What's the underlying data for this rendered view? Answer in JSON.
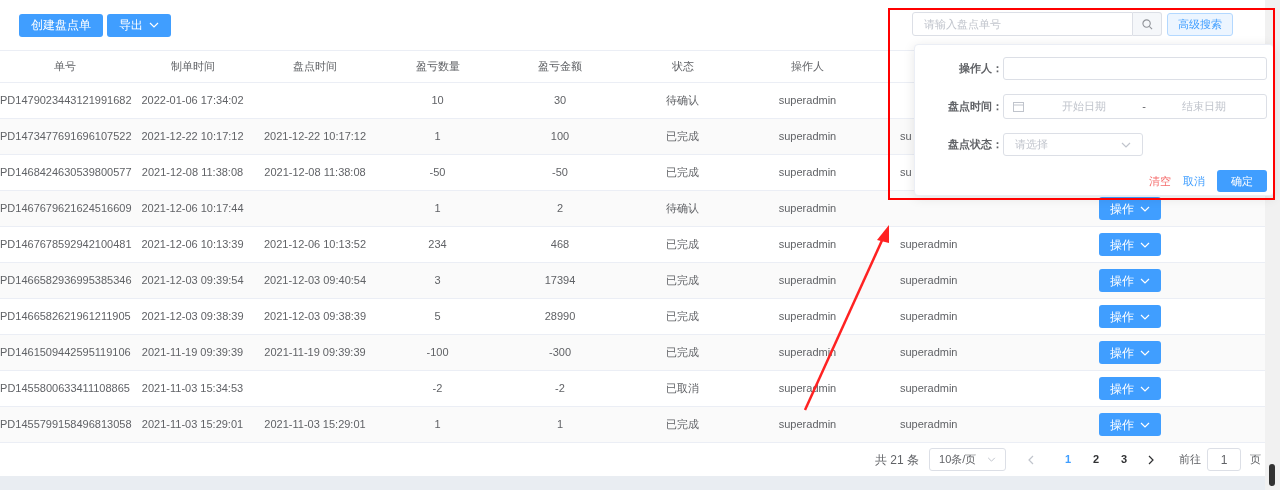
{
  "toolbar": [
    {
      "label": "创建盘点单",
      "kind": "plain"
    },
    {
      "label": "导出",
      "kind": "dropdown"
    }
  ],
  "search": {
    "placeholder": "请输入盘点单号",
    "advanced_button": "高级搜索"
  },
  "table": {
    "columns": [
      "单号",
      "制单时间",
      "盘点时间",
      "盈亏数量",
      "盈亏金额",
      "状态",
      "操作人"
    ],
    "rows": [
      {
        "cells": [
          "PD1479023443121991682",
          "2022-01-06 17:34:02",
          "",
          "10",
          "30",
          "待确认",
          "superadmin"
        ]
      },
      {
        "cells": [
          "PD1473477691696107522",
          "2021-12-22 10:17:12",
          "2021-12-22 10:17:12",
          "1",
          "100",
          "已完成",
          "superadmin"
        ],
        "column_8": "su"
      },
      {
        "cells": [
          "PD1468424630539800577",
          "2021-12-08 11:38:08",
          "2021-12-08 11:38:08",
          "-50",
          "-50",
          "已完成",
          "superadmin"
        ],
        "column_8": "su"
      },
      {
        "cells": [
          "PD1467679621624516609",
          "2021-12-06 10:17:44",
          "",
          "1",
          "2",
          "待确认",
          "superadmin"
        ],
        "column_9": "操作"
      },
      {
        "cells": [
          "PD1467678592942100481",
          "2021-12-06 10:13:39",
          "2021-12-06 10:13:52",
          "234",
          "468",
          "已完成",
          "superadmin"
        ],
        "column_8": "superadmin",
        "column_9": "操作"
      },
      {
        "cells": [
          "PD1466582936995385346",
          "2021-12-03 09:39:54",
          "2021-12-03 09:40:54",
          "3",
          "17394",
          "已完成",
          "superadmin"
        ],
        "column_8": "superadmin",
        "column_9": "操作"
      },
      {
        "cells": [
          "PD1466582621961211905",
          "2021-12-03 09:38:39",
          "2021-12-03 09:38:39",
          "5",
          "28990",
          "已完成",
          "superadmin"
        ],
        "column_8": "superadmin",
        "column_9": "操作"
      },
      {
        "cells": [
          "PD1461509442595119106",
          "2021-11-19 09:39:39",
          "2021-11-19 09:39:39",
          "-100",
          "-300",
          "已完成",
          "superadmin"
        ],
        "column_8": "superadmin",
        "column_9": "操作"
      },
      {
        "cells": [
          "PD1455800633411108865",
          "2021-11-03 15:34:53",
          "",
          "-2",
          "-2",
          "已取消",
          "superadmin"
        ],
        "column_8": "superadmin",
        "column_9": "操作"
      },
      {
        "cells": [
          "PD1455799158496813058",
          "2021-11-03 15:29:01",
          "2021-11-03 15:29:01",
          "1",
          "1",
          "已完成",
          "superadmin"
        ],
        "column_8": "superadmin",
        "column_9": "操作"
      }
    ]
  },
  "advanced_search": {
    "fields": [
      {
        "label": "操作人：",
        "kind": "text"
      },
      {
        "label": "盘点时间：",
        "kind": "date_range",
        "start_placeholder": "开始日期",
        "separator": "-",
        "end_placeholder": "结束日期"
      },
      {
        "label": "盘点状态：",
        "kind": "select",
        "placeholder": "请选择"
      }
    ],
    "buttons": [
      {
        "label": "清空",
        "kind": "danger"
      },
      {
        "label": "取消",
        "kind": "link"
      },
      {
        "label": "确定",
        "kind": "primary"
      }
    ]
  },
  "pagination": {
    "total": "共 21 条",
    "page_size": "10条/页",
    "pages": [
      {
        "label": "1",
        "selected": true
      },
      {
        "label": "2",
        "selected": false
      },
      {
        "label": "3",
        "selected": false
      }
    ],
    "goto_label": "前往",
    "goto_value": "1",
    "goto_suffix": "页"
  }
}
